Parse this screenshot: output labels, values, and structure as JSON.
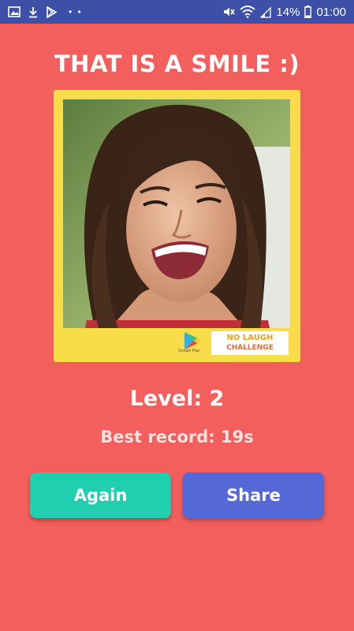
{
  "status_bar": {
    "battery": "14%",
    "time": "01:00",
    "left_icons": [
      "image-icon",
      "download-icon",
      "play-store-icon",
      "more-dots-icon"
    ],
    "right_icons": [
      "mute-icon",
      "wifi-icon",
      "signal-icon",
      "battery-icon"
    ]
  },
  "title": "THAT IS A SMILE :)",
  "photo": {
    "store_badge": "Google Play",
    "brand_line1": "NO LAUGH",
    "brand_line2": "CHALLENGE"
  },
  "level_text": "Level: 2",
  "record_text": "Best record: 19s",
  "buttons": {
    "again": "Again",
    "share": "Share"
  },
  "colors": {
    "background": "#f25f5c",
    "status_bar": "#3d4fa6",
    "frame": "#f8dc4a",
    "again_button": "#1fcfaf",
    "share_button": "#5468d8"
  }
}
